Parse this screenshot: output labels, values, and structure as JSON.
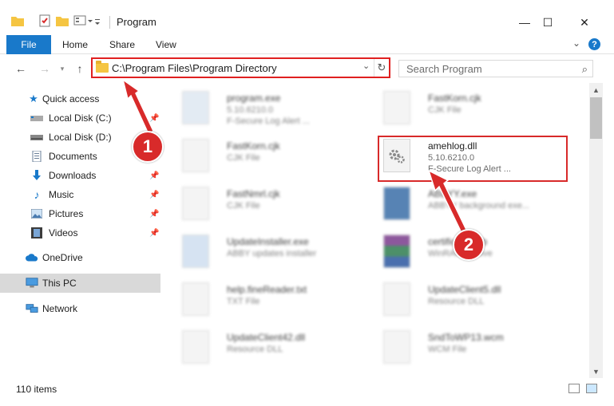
{
  "window": {
    "title": "Program",
    "controls": {
      "minimize": "—",
      "maximize": "☐",
      "close": "✕"
    }
  },
  "ribbon": {
    "tabs": [
      "File",
      "Home",
      "Share",
      "View"
    ],
    "expand_glyph": "⌄",
    "help_glyph": "?"
  },
  "navigation": {
    "address": "C:\\Program Files\\Program Directory",
    "search_placeholder": "Search Program"
  },
  "sidebar": {
    "quick_access": "Quick access",
    "items": [
      {
        "label": "Local Disk (C:)",
        "icon": "drive-icon",
        "pinned": true
      },
      {
        "label": "Local Disk (D:)",
        "icon": "drive-icon",
        "pinned": false
      },
      {
        "label": "Documents",
        "icon": "documents-icon",
        "pinned": true
      },
      {
        "label": "Downloads",
        "icon": "downloads-icon",
        "pinned": true
      },
      {
        "label": "Music",
        "icon": "music-icon",
        "pinned": true
      },
      {
        "label": "Pictures",
        "icon": "pictures-icon",
        "pinned": true
      },
      {
        "label": "Videos",
        "icon": "videos-icon",
        "pinned": true
      }
    ],
    "onedrive": "OneDrive",
    "this_pc": "This PC",
    "network": "Network"
  },
  "files": [
    {
      "name": "program.exe",
      "line1": "5.10.6210.0",
      "line2": "F-Secure Log Alert ...",
      "blurred": true
    },
    {
      "name": "FastKorn.cjk",
      "line1": "CJK File",
      "line2": "",
      "blurred": true
    },
    {
      "name": "FastKorn.cjk",
      "line1": "CJK File",
      "line2": "",
      "blurred": true
    },
    {
      "name": "amehlog.dll",
      "line1": "5.10.6210.0",
      "line2": "F-Secure Log Alert ...",
      "blurred": false
    },
    {
      "name": "FastNmrl.cjk",
      "line1": "CJK File",
      "line2": "",
      "blurred": true
    },
    {
      "name": "ABBYY.exe",
      "line1": "ABBYY background exe...",
      "line2": "",
      "blurred": true
    },
    {
      "name": "UpdateInstaller.exe",
      "line1": "ABBY updates installer",
      "line2": "",
      "blurred": true
    },
    {
      "name": "certificate.cab",
      "line1": "WinRAR archive",
      "line2": "",
      "blurred": true
    },
    {
      "name": "help.fineReader.txt",
      "line1": "TXT File",
      "line2": "",
      "blurred": true
    },
    {
      "name": "UpdateClient5.dll",
      "line1": "Resource DLL",
      "line2": "",
      "blurred": true
    },
    {
      "name": "UpdateClient42.dll",
      "line1": "Resource DLL",
      "line2": "",
      "blurred": true
    },
    {
      "name": "SndToWP13.wcm",
      "line1": "WCM File",
      "line2": "",
      "blurred": true
    }
  ],
  "status": {
    "item_count": "110 items"
  },
  "annotations": {
    "callout_1": "1",
    "callout_2": "2"
  },
  "colors": {
    "accent": "#1979ca",
    "highlight": "#d82a2a",
    "selected": "#cce8ff"
  }
}
